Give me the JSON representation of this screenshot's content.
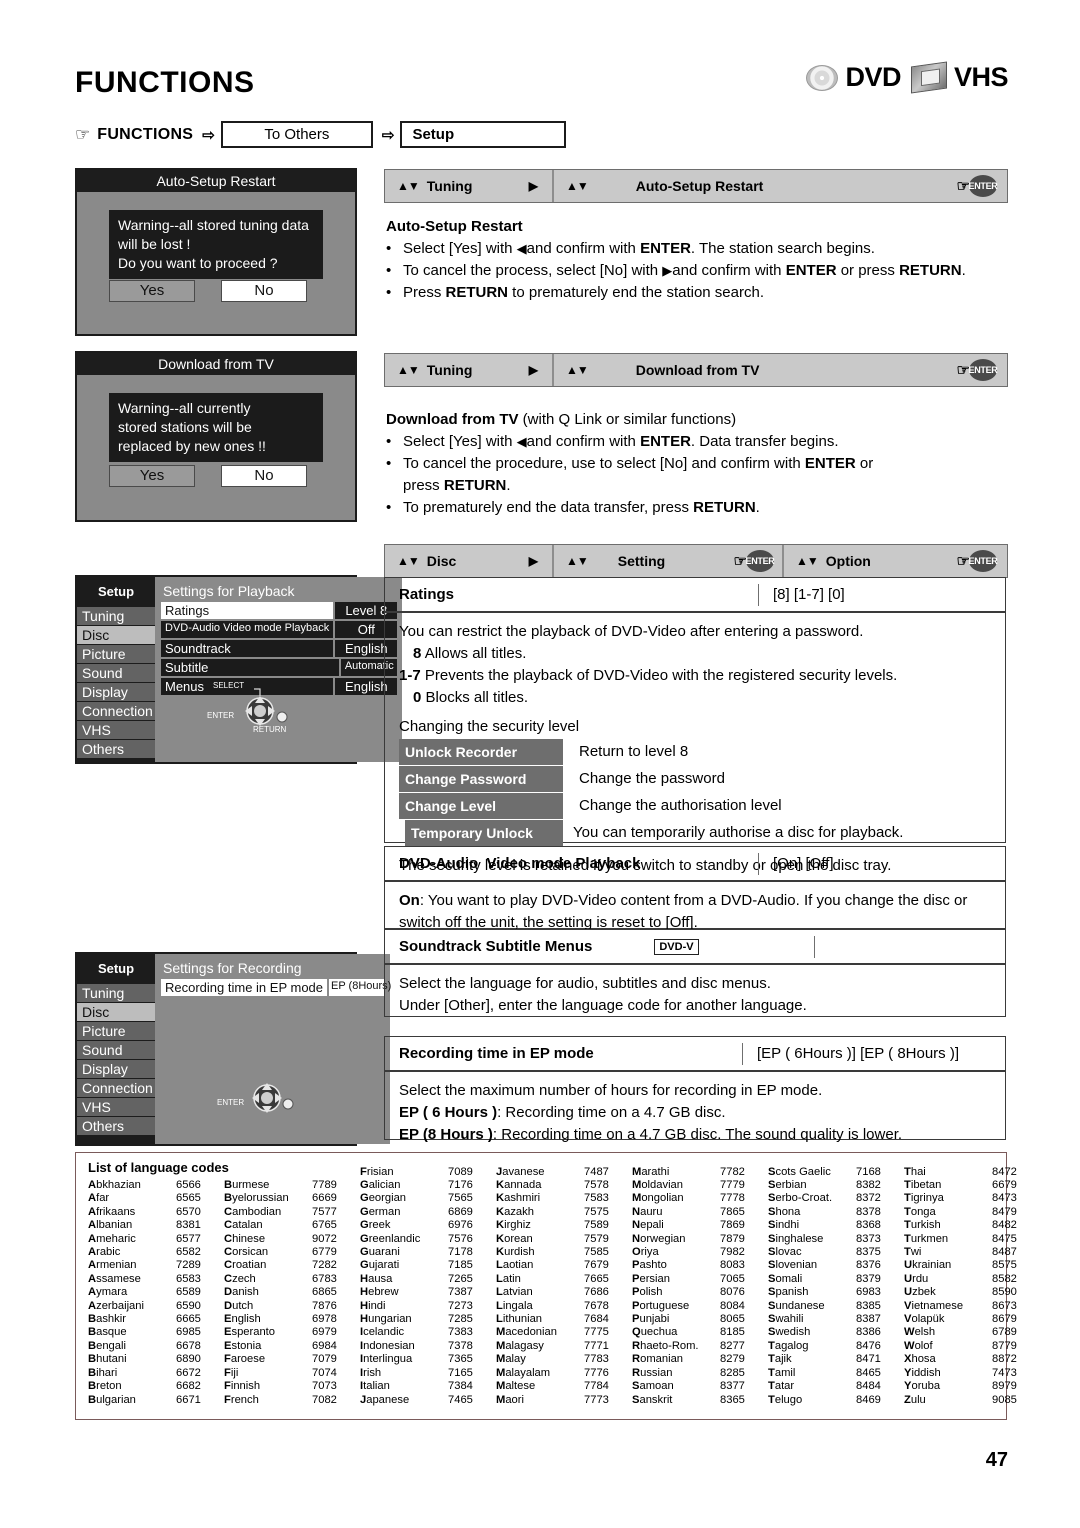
{
  "header": {
    "title": "FUNCTIONS",
    "media": [
      {
        "icon": "disc-icon",
        "label": "DVD"
      },
      {
        "icon": "vhs-cassette-icon",
        "label": "VHS"
      }
    ]
  },
  "breadcrumb": {
    "hand": "☞",
    "root": "FUNCTIONS",
    "arrow": "⇨",
    "step1": "To Others",
    "step2": "Setup"
  },
  "osd_dialogs": [
    {
      "title": "Auto-Setup Restart",
      "message": "Warning--all stored tuning data\nwill be lost !\nDo you want to proceed ?",
      "yes": "Yes",
      "no": "No"
    },
    {
      "title": "Download from TV",
      "message": "Warning--all currently\nstored stations will be\nreplaced by new ones !!",
      "yes": "Yes",
      "no": "No"
    }
  ],
  "setup_menus": [
    {
      "side_title": "Setup",
      "side_items": [
        "Tuning",
        "Disc",
        "Picture",
        "Sound",
        "Display",
        "Connection",
        "VHS",
        "Others"
      ],
      "selected": "Disc",
      "pane_title": "Settings for Playback",
      "rows": [
        {
          "label": "Ratings",
          "value": "Level 8",
          "label_highlight": true,
          "value_highlight": false
        },
        {
          "label": "DVD-Audio Video mode Playback",
          "value": "Off",
          "label_highlight": false,
          "value_highlight": false
        },
        {
          "label": "Soundtrack",
          "value": "English",
          "label_highlight": false,
          "value_highlight": false
        },
        {
          "label": "Subtitle",
          "value": "Automatic",
          "label_highlight": false,
          "value_highlight": false
        },
        {
          "label": "Menus",
          "value": "English",
          "label_highlight": false,
          "value_highlight": false
        }
      ],
      "pad_labels": [
        "SELECT",
        "ENTER",
        "RETURN"
      ]
    },
    {
      "side_title": "Setup",
      "side_items": [
        "Tuning",
        "Disc",
        "Picture",
        "Sound",
        "Display",
        "Connection",
        "VHS",
        "Others"
      ],
      "selected": "Disc",
      "pane_title": "Settings for Recording",
      "rows": [
        {
          "label": "Recording time in EP mode",
          "value": "EP (8Hours)",
          "label_highlight": true,
          "value_highlight": true
        }
      ],
      "pad_labels": [
        "ENTER"
      ]
    }
  ],
  "navbars": [
    {
      "segments": [
        {
          "updown": "▲▼",
          "label": "Tuning",
          "right_icon": "play-right-arrow"
        },
        {
          "updown": "▲▼",
          "label": "Auto-Setup Restart",
          "enter": "ENTER",
          "hand": "☞"
        }
      ]
    },
    {
      "segments": [
        {
          "updown": "▲▼",
          "label": "Tuning",
          "right_icon": "play-right-arrow"
        },
        {
          "updown": "▲▼",
          "label": "Download from TV",
          "enter": "ENTER",
          "hand": "☞"
        }
      ]
    },
    {
      "segments": [
        {
          "updown": "▲▼",
          "label": "Disc",
          "right_icon": "play-right-arrow"
        },
        {
          "updown": "▲▼",
          "label": "Setting",
          "enter": "ENTER",
          "hand": "☞"
        },
        {
          "updown": "▲▼",
          "label": "Option",
          "enter": "ENTER",
          "hand": "☞"
        }
      ]
    }
  ],
  "sections": {
    "auto_setup": {
      "heading": "Auto-Setup Restart",
      "bullets": [
        "Select [Yes] with ◀ and confirm with ENTER. The station search begins.",
        "To cancel the process, select [No] with ▶ and confirm with ENTER or press RETURN.",
        "Press RETURN to prematurely end the station search."
      ]
    },
    "download_tv": {
      "heading": "Download from TV",
      "heading_suffix": "(with Q Link or similar functions)",
      "bullets": [
        "Select [Yes] with ◀ and confirm with ENTER. Data transfer begins.",
        "To cancel the procedure, use to select [No] and confirm with ENTER or press RETURN.",
        "To prematurely end the data transfer, press RETURN."
      ]
    },
    "ratings": {
      "title": "Ratings",
      "options": "[8] [1-7] [0]",
      "intro": "You can restrict the playback of DVD-Video after entering a password.",
      "levels": [
        {
          "key": "8",
          "text": "Allows all titles."
        },
        {
          "key": "1-7",
          "text": "Prevents the playback of DVD-Video with the registered security levels."
        },
        {
          "key": "0",
          "text": "Blocks all titles."
        }
      ],
      "changing_title": "Changing the security level",
      "actions": [
        {
          "tag": "Unlock Recorder",
          "desc": "Return to level 8"
        },
        {
          "tag": "Change Password",
          "desc": "Change the password"
        },
        {
          "tag": "Change Level",
          "desc": "Change the authorisation level"
        },
        {
          "tag": "Temporary Unlock",
          "desc": "You can temporarily authorise a disc for playback."
        }
      ],
      "footer": "The security level is retained if you switch to standby or open the disc tray."
    },
    "dvd_audio": {
      "title": "DVD-Audio Video mode Playback",
      "title_bold_prefix": "DVD-Audio",
      "options": "[On] [Off]",
      "body": "On: You want to play DVD-Video content from a DVD-Audio. If you change the disc or switch off the unit, the setting is reset to [Off]."
    },
    "soundtrack": {
      "title": "Soundtrack  Subtitle  Menus",
      "badge": "DVD-V",
      "body_line1": "Select the language for audio, subtitles and disc menus.",
      "body_line2": "Under [Other], enter the language code for another language."
    },
    "recording_time": {
      "title": "Recording time in EP mode",
      "options": "[EP ( 6Hours )] [EP ( 8Hours )]",
      "body_line1": "Select the maximum number of hours for recording in EP mode.",
      "body_line2_key": "EP ( 6 Hours )",
      "body_line2": ": Recording time on a 4.7 GB disc.",
      "body_line3_key": "EP (8 Hours )",
      "body_line3": ": Recording time on a 4.7 GB disc. The sound quality is lower."
    }
  },
  "language_codes": {
    "title": "List of language codes",
    "columns": [
      [
        [
          "Abkhazian",
          "6566"
        ],
        [
          "Afar",
          "6565"
        ],
        [
          "Afrikaans",
          "6570"
        ],
        [
          "Albanian",
          "8381"
        ],
        [
          "Ameharic",
          "6577"
        ],
        [
          "Arabic",
          "6582"
        ],
        [
          "Armenian",
          "7289"
        ],
        [
          "Assamese",
          "6583"
        ],
        [
          "Aymara",
          "6589"
        ],
        [
          "Azerbaijani",
          "6590"
        ],
        [
          "Bashkir",
          "6665"
        ],
        [
          "Basque",
          "6985"
        ],
        [
          "Bengali",
          "6678"
        ],
        [
          "Bhutani",
          "6890"
        ],
        [
          "Bihari",
          "6672"
        ],
        [
          "Breton",
          "6682"
        ],
        [
          "Bulgarian",
          "6671"
        ]
      ],
      [
        [
          "Burmese",
          "7789"
        ],
        [
          "Byelorussian",
          "6669"
        ],
        [
          "Cambodian",
          "7577"
        ],
        [
          "Catalan",
          "6765"
        ],
        [
          "Chinese",
          "9072"
        ],
        [
          "Corsican",
          "6779"
        ],
        [
          "Croatian",
          "7282"
        ],
        [
          "Czech",
          "6783"
        ],
        [
          "Danish",
          "6865"
        ],
        [
          "Dutch",
          "7876"
        ],
        [
          "English",
          "6978"
        ],
        [
          "Esperanto",
          "6979"
        ],
        [
          "Estonia",
          "6984"
        ],
        [
          "Faroese",
          "7079"
        ],
        [
          "Fiji",
          "7074"
        ],
        [
          "Finnish",
          "7073"
        ],
        [
          "French",
          "7082"
        ]
      ],
      [
        [
          "Frisian",
          "7089"
        ],
        [
          "Galician",
          "7176"
        ],
        [
          "Georgian",
          "7565"
        ],
        [
          "German",
          "6869"
        ],
        [
          "Greek",
          "6976"
        ],
        [
          "Greenlandic",
          "7576"
        ],
        [
          "Guarani",
          "7178"
        ],
        [
          "Gujarati",
          "7185"
        ],
        [
          "Hausa",
          "7265"
        ],
        [
          "Hebrew",
          "7387"
        ],
        [
          "Hindi",
          "7273"
        ],
        [
          "Hungarian",
          "7285"
        ],
        [
          "Icelandic",
          "7383"
        ],
        [
          "Indonesian",
          "7378"
        ],
        [
          "Interlingua",
          "7365"
        ],
        [
          "Irish",
          "7165"
        ],
        [
          "Italian",
          "7384"
        ],
        [
          "Japanese",
          "7465"
        ]
      ],
      [
        [
          "Javanese",
          "7487"
        ],
        [
          "Kannada",
          "7578"
        ],
        [
          "Kashmiri",
          "7583"
        ],
        [
          "Kazakh",
          "7575"
        ],
        [
          "Kirghiz",
          "7589"
        ],
        [
          "Korean",
          "7579"
        ],
        [
          "Kurdish",
          "7585"
        ],
        [
          "Laotian",
          "7679"
        ],
        [
          "Latin",
          "7665"
        ],
        [
          "Latvian",
          "7686"
        ],
        [
          "Lingala",
          "7678"
        ],
        [
          "Lithunian",
          "7684"
        ],
        [
          "Macedonian",
          "7775"
        ],
        [
          "Malagasy",
          "7771"
        ],
        [
          "Malay",
          "7783"
        ],
        [
          "Malayalam",
          "7776"
        ],
        [
          "Maltese",
          "7784"
        ],
        [
          "Maori",
          "7773"
        ]
      ],
      [
        [
          "Marathi",
          "7782"
        ],
        [
          "Moldavian",
          "7779"
        ],
        [
          "Mongolian",
          "7778"
        ],
        [
          "Nauru",
          "7865"
        ],
        [
          "Nepali",
          "7869"
        ],
        [
          "Norwegian",
          "7879"
        ],
        [
          "Oriya",
          "7982"
        ],
        [
          "Pashto",
          "8083"
        ],
        [
          "Persian",
          "7065"
        ],
        [
          "Polish",
          "8076"
        ],
        [
          "Portuguese",
          "8084"
        ],
        [
          "Punjabi",
          "8065"
        ],
        [
          "Quechua",
          "8185"
        ],
        [
          "Rhaeto-Rom.",
          "8277"
        ],
        [
          "Romanian",
          "8279"
        ],
        [
          "Russian",
          "8285"
        ],
        [
          "Samoan",
          "8377"
        ],
        [
          "Sanskrit",
          "8365"
        ]
      ],
      [
        [
          "Scots Gaelic",
          "7168"
        ],
        [
          "Serbian",
          "8382"
        ],
        [
          "Serbo-Croat.",
          "8372"
        ],
        [
          "Shona",
          "8378"
        ],
        [
          "Sindhi",
          "8368"
        ],
        [
          "Singhalese",
          "8373"
        ],
        [
          "Slovac",
          "8375"
        ],
        [
          "Slovenian",
          "8376"
        ],
        [
          "Somali",
          "8379"
        ],
        [
          "Spanish",
          "6983"
        ],
        [
          "Sundanese",
          "8385"
        ],
        [
          "Swahili",
          "8387"
        ],
        [
          "Swedish",
          "8386"
        ],
        [
          "Tagalog",
          "8476"
        ],
        [
          "Tajik",
          "8471"
        ],
        [
          "Tamil",
          "8465"
        ],
        [
          "Tatar",
          "8484"
        ],
        [
          "Telugo",
          "8469"
        ]
      ],
      [
        [
          "Thai",
          "8472"
        ],
        [
          "Tibetan",
          "6679"
        ],
        [
          "Tigrinya",
          "8473"
        ],
        [
          "Tonga",
          "8479"
        ],
        [
          "Turkish",
          "8482"
        ],
        [
          "Turkmen",
          "8475"
        ],
        [
          "Twi",
          "8487"
        ],
        [
          "Ukrainian",
          "8575"
        ],
        [
          "Urdu",
          "8582"
        ],
        [
          "Uzbek",
          "8590"
        ],
        [
          "Vietnamese",
          "8673"
        ],
        [
          "Volapük",
          "8679"
        ],
        [
          "Welsh",
          "6789"
        ],
        [
          "Wolof",
          "8779"
        ],
        [
          "Xhosa",
          "8872"
        ],
        [
          "Yiddish",
          "7473"
        ],
        [
          "Yoruba",
          "8979"
        ],
        [
          "Zulu",
          "9085"
        ]
      ]
    ]
  },
  "page_number": "47"
}
